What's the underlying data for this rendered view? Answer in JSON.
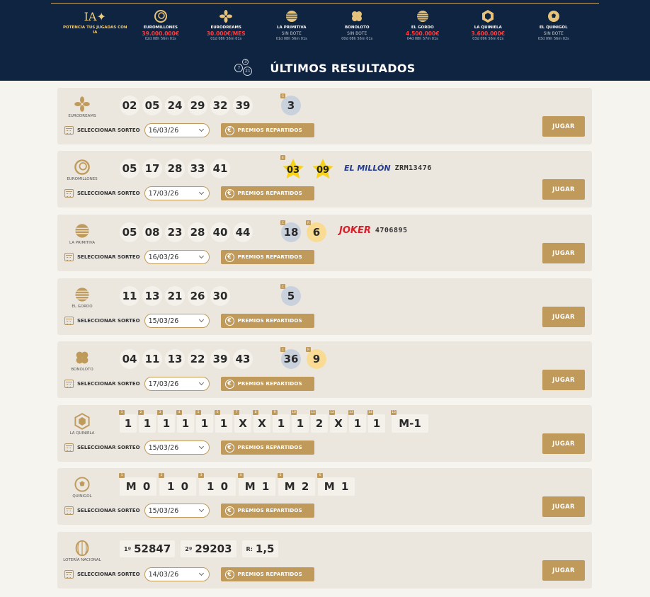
{
  "colors": {
    "navy": "#0f2440",
    "gold": "#c09a5a",
    "jackpot": "#ff3b3b",
    "blue_ball": "#c9d1dc",
    "yellow_ball": "#fadb93"
  },
  "header": {
    "games": [
      {
        "name": "POTENCIA TUS JUGADAS CON IA",
        "icon": "ia-sparkle-icon",
        "jackpot": "",
        "time": ""
      },
      {
        "name": "EUROMILLONES",
        "icon": "euromillones-icon",
        "jackpot": "39.000.000€",
        "time": "02d 08h 56m 01s"
      },
      {
        "name": "EURODREAMS",
        "icon": "eurodreams-icon",
        "jackpot": "30.000€/MES",
        "time": "01d 08h 56m 01s"
      },
      {
        "name": "LA PRIMITIVA",
        "icon": "primitiva-icon",
        "jackpot": "SIN BOTE",
        "time": "01d 08h 56m 01s"
      },
      {
        "name": "BONOLOTO",
        "icon": "bonoloto-icon",
        "jackpot": "SIN BOTE",
        "time": "00d 08h 56m 01s"
      },
      {
        "name": "EL GORDO",
        "icon": "el-gordo-icon",
        "jackpot": "4.500.000€",
        "time": "04d 08h 57m 01s"
      },
      {
        "name": "LA QUINIELA",
        "icon": "quiniela-icon",
        "jackpot": "3.600.000€",
        "time": "03d 09h 56m 02s"
      },
      {
        "name": "EL QUINIGOL",
        "icon": "quinigol-icon",
        "jackpot": "SIN BOTE",
        "time": "03d 09h 56m 02s"
      }
    ],
    "section_title": "ÚLTIMOS RESULTADOS",
    "section_logo_numbers": [
      "7",
      "3",
      "21"
    ]
  },
  "labels": {
    "select": "SELECCIONAR SORTEO",
    "premios": "PREMIOS REPARTIDOS",
    "play": "JUGAR",
    "euro": "€"
  },
  "results": {
    "eurodreams": {
      "name": "EURODREAMS",
      "numbers": [
        "02",
        "05",
        "24",
        "29",
        "32",
        "39"
      ],
      "extra_tag": "S",
      "extra": "3",
      "date": "16/03/26"
    },
    "euromillones": {
      "name": "EUROMILLONES",
      "numbers": [
        "05",
        "17",
        "28",
        "33",
        "41"
      ],
      "star_tag": "E",
      "stars": [
        "03",
        "09"
      ],
      "millon_label": "EL MILLÓN",
      "millon_code": "ZRM13476",
      "date": "17/03/26"
    },
    "primitiva": {
      "name": "LA PRIMITIVA",
      "numbers": [
        "05",
        "08",
        "23",
        "28",
        "40",
        "44"
      ],
      "c_tag": "C",
      "complementario": "18",
      "r_tag": "R",
      "reintegro": "6",
      "joker_label": "JOKER",
      "joker": "4706895",
      "date": "16/03/26"
    },
    "gordo": {
      "name": "EL GORDO",
      "numbers": [
        "11",
        "13",
        "21",
        "26",
        "30"
      ],
      "c_tag": "C",
      "clave": "5",
      "date": "15/03/26"
    },
    "bonoloto": {
      "name": "BONOLOTO",
      "numbers": [
        "04",
        "11",
        "13",
        "22",
        "39",
        "43"
      ],
      "c_tag": "C",
      "complementario": "36",
      "r_tag": "R",
      "reintegro": "9",
      "date": "17/03/26"
    },
    "quiniela": {
      "name": "LA QUINIELA",
      "matches": [
        {
          "n": "1",
          "v": "1"
        },
        {
          "n": "2",
          "v": "1"
        },
        {
          "n": "3",
          "v": "1"
        },
        {
          "n": "4",
          "v": "1"
        },
        {
          "n": "5",
          "v": "1"
        },
        {
          "n": "6",
          "v": "1"
        },
        {
          "n": "7",
          "v": "X"
        },
        {
          "n": "8",
          "v": "X"
        },
        {
          "n": "9",
          "v": "1"
        },
        {
          "n": "10",
          "v": "1"
        },
        {
          "n": "11",
          "v": "2"
        },
        {
          "n": "12",
          "v": "X"
        },
        {
          "n": "13",
          "v": "1"
        },
        {
          "n": "14",
          "v": "1"
        },
        {
          "n": "15",
          "v": "M-1"
        }
      ],
      "date": "15/03/26"
    },
    "quinigol": {
      "name": "QUINIGOL",
      "matches": [
        {
          "n": "1",
          "v": "M 0"
        },
        {
          "n": "2",
          "v": "1 0"
        },
        {
          "n": "3",
          "v": "1 0"
        },
        {
          "n": "4",
          "v": "M 1"
        },
        {
          "n": "5",
          "v": "M 2"
        },
        {
          "n": "6",
          "v": "M 1"
        }
      ],
      "date": "15/03/26"
    },
    "nacional": {
      "name": "LOTERÍA NACIONAL",
      "first_label": "1º",
      "first": "52847",
      "second_label": "2º",
      "second": "29203",
      "r_label": "R:",
      "reintegro": "1,5",
      "date": "14/03/26"
    }
  }
}
